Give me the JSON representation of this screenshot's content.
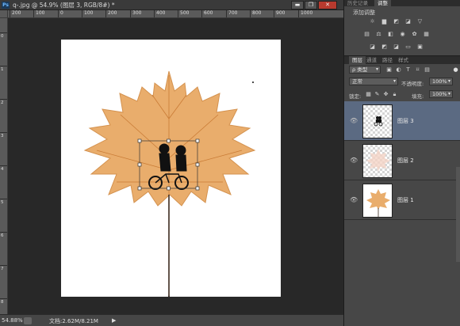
{
  "document": {
    "title": "q-.jpg @ 54.9% (图层 3, RGB/8#) *",
    "ps_badge": "Ps",
    "win_controls": {
      "minimize": "▬",
      "restore": "❐",
      "close": "✕"
    }
  },
  "rulers": {
    "horizontal": [
      "200",
      "100",
      "0",
      "100",
      "200",
      "300",
      "400",
      "500",
      "600",
      "700",
      "800",
      "900",
      "1000"
    ],
    "vertical": [
      "0",
      "1",
      "2",
      "3",
      "4",
      "5",
      "6",
      "7",
      "8"
    ]
  },
  "status_bar": {
    "zoom": "54.88%",
    "doc_size": "文档:2.62M/8.21M",
    "arrow": "▶"
  },
  "adjustments": {
    "tabs": [
      "历史记录",
      "调整"
    ],
    "label": "添加调整",
    "row1_icons": [
      "brightness-icon",
      "levels-icon",
      "curves-icon",
      "exposure-icon",
      "vibrance-triangle-icon"
    ],
    "row2_icons": [
      "hue-saturation-icon",
      "color-balance-icon",
      "black-white-icon",
      "photo-filter-icon",
      "channel-mixer-icon",
      "color-lookup-icon"
    ],
    "row3_icons": [
      "invert-icon",
      "posterize-icon",
      "threshold-icon",
      "gradient-map-icon",
      "selective-color-icon"
    ]
  },
  "layers": {
    "tabs": [
      "图层",
      "通道",
      "路径",
      "样式"
    ],
    "filter_kind": "ρ 类型",
    "blend_mode": "正常",
    "opacity_label": "不透明度:",
    "opacity_value": "100%",
    "lock_label": "锁定:",
    "fill_label": "填充:",
    "fill_value": "100%",
    "items": [
      {
        "name": "图层 3",
        "selected": true
      },
      {
        "name": "图层 2",
        "selected": false
      },
      {
        "name": "图层 1",
        "selected": false
      }
    ]
  },
  "colors": {
    "leaf": "#e9ad6c",
    "leaf_vein": "#c97b35",
    "selected_layer": "#5b6a82"
  }
}
